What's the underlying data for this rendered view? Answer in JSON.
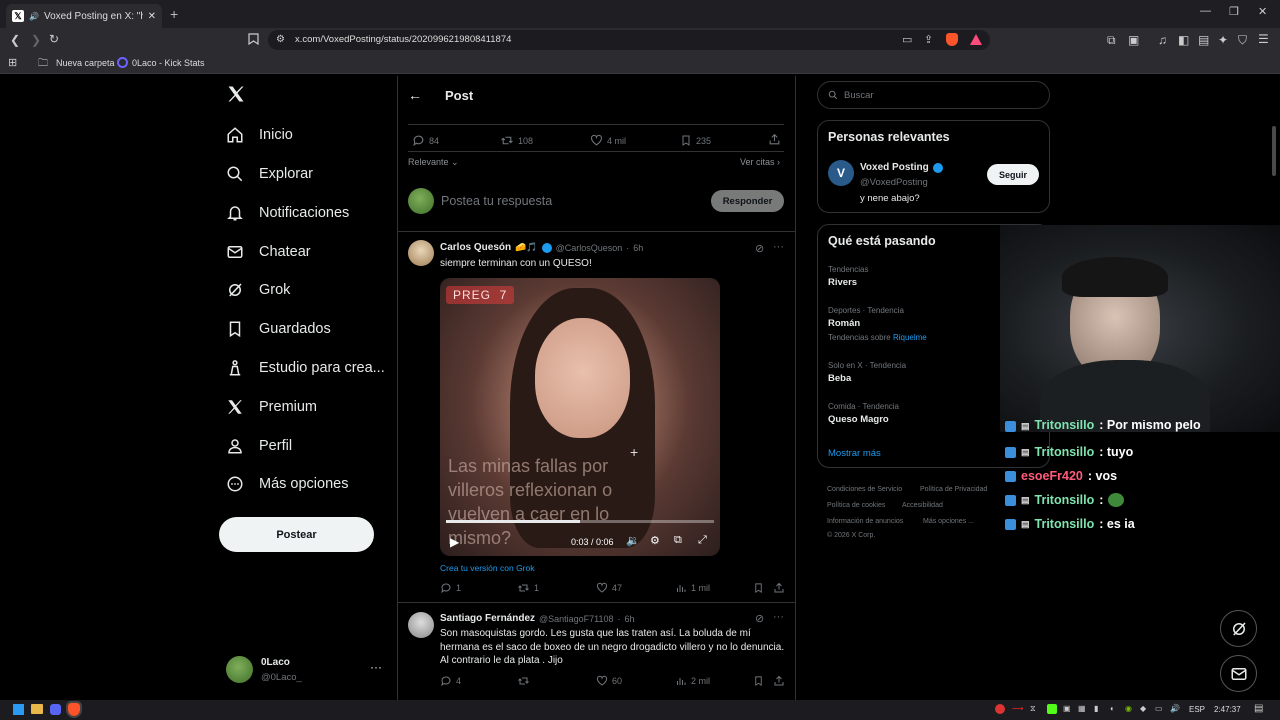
{
  "browser": {
    "tab_title": "Voxed Posting en X: \"https://",
    "url": "x.com/VoxedPosting/status/2020996219808411874",
    "bookmarks": [
      "Nueva carpeta",
      "0Laco - Kick Stats"
    ]
  },
  "nav": {
    "items": [
      {
        "label": "Inicio",
        "icon": "home-icon"
      },
      {
        "label": "Explorar",
        "icon": "search-icon"
      },
      {
        "label": "Notificaciones",
        "icon": "bell-icon"
      },
      {
        "label": "Chatear",
        "icon": "mail-icon"
      },
      {
        "label": "Grok",
        "icon": "grok-icon"
      },
      {
        "label": "Guardados",
        "icon": "bookmark-icon"
      },
      {
        "label": "Estudio para crea...",
        "icon": "creator-studio-icon"
      },
      {
        "label": "Premium",
        "icon": "x-logo-icon"
      },
      {
        "label": "Perfil",
        "icon": "person-icon"
      },
      {
        "label": "Más opciones",
        "icon": "more-circle-icon"
      }
    ],
    "post_button": "Postear",
    "account": {
      "name": "0Laco",
      "handle": "@0Laco_"
    }
  },
  "header": {
    "title": "Post"
  },
  "main_post": {
    "stats": {
      "replies": "84",
      "reposts": "108",
      "likes": "4 mil",
      "bookmarks": "235"
    },
    "sort_label": "Relevante",
    "quotes_link": "Ver citas",
    "reply_placeholder": "Postea tu respuesta",
    "reply_button": "Responder"
  },
  "replies": [
    {
      "name": "Carlos Quesón",
      "name_emojis": "🧀🎵",
      "handle": "@CarlosQueson",
      "time": "6h",
      "text": "siempre terminan con un QUESO!",
      "video": {
        "badge": "PREG  7",
        "caption": "Las minas fallas por villeros reflexionan o vuelven a caer en lo mismo?",
        "time": "0:03 / 0:06",
        "progress": 0.5
      },
      "grok_link": "Crea tu versión con Grok",
      "stats": {
        "replies": "1",
        "reposts": "1",
        "likes": "47",
        "views": "1 mil"
      }
    },
    {
      "name": "Santiago Fernández",
      "handle": "@SantiagoF71108",
      "time": "6h",
      "text": "Son masoquistas gordo. Les gusta que las traten así. La boluda de mí hermana es el saco de boxeo de un negro drogadicto villero y no lo denuncia. Al contrario le da plata . Jijo",
      "stats": {
        "replies": "4",
        "reposts": "",
        "likes": "60",
        "views": "2 mil"
      }
    }
  ],
  "sidebar": {
    "search_placeholder": "Buscar",
    "relevant": {
      "title": "Personas relevantes",
      "name": "Voxed Posting",
      "handle": "@VoxedPosting",
      "bio": "y nene abajo?",
      "follow": "Seguir"
    },
    "trends": {
      "title": "Qué está pasando",
      "items": [
        {
          "label": "Tendencias",
          "topic": "Rivers",
          "sub": "",
          "sub_link": ""
        },
        {
          "label": "Deportes · Tendencia",
          "topic": "Román",
          "sub": "Tendencias sobre",
          "sub_link": "Riquelme"
        },
        {
          "label": "Solo en X · Tendencia",
          "topic": "Beba",
          "sub": "",
          "sub_link": ""
        },
        {
          "label": "Comida · Tendencia",
          "topic": "Queso Magro",
          "sub": "",
          "sub_link": ""
        }
      ],
      "more": "Mostrar más"
    },
    "footer": [
      "Condiciones de Servicio",
      "Política de Privacidad",
      "Política de cookies",
      "Accesibilidad",
      "Información de anuncios",
      "Más opciones ...",
      "© 2026 X Corp."
    ]
  },
  "chat": [
    {
      "user": "Tritonsillo",
      "msg": ": Por mismo pelo",
      "color": "#7fe3b0"
    },
    {
      "user": "Tritonsillo",
      "msg": ": tuyo",
      "color": "#7fe3b0"
    },
    {
      "user": "esoeFr420",
      "msg": ": vos",
      "color": "#ff5b7a"
    },
    {
      "user": "Tritonsillo",
      "msg": ":",
      "color": "#7fe3b0"
    },
    {
      "user": "Tritonsillo",
      "msg": ": es ia",
      "color": "#7fe3b0"
    }
  ],
  "taskbar": {
    "lang": "ESP",
    "clock": "2:47:37"
  },
  "colors": {
    "accent": "#1d9bf0",
    "grok_link": "#1d9bf0"
  }
}
